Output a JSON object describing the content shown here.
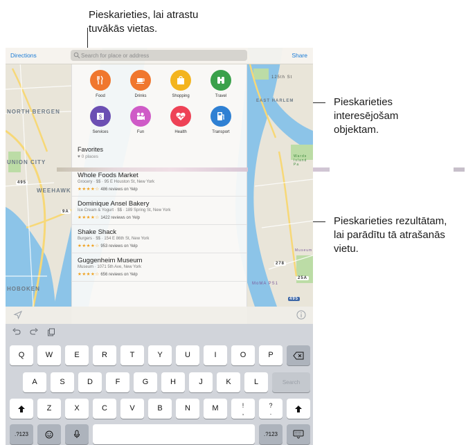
{
  "callouts": {
    "search": [
      "Pieskarieties, lai atrastu",
      "tuvākās vietas."
    ],
    "categories": [
      "Pieskarieties",
      "interesējošam",
      "objektam."
    ],
    "results": [
      "Pieskarieties rezultātam,",
      "lai parādītu tā atrašanās",
      "vietu."
    ]
  },
  "topbar": {
    "directions_label": "Directions",
    "share_label": "Share",
    "search_placeholder": "Search for place or address"
  },
  "map": {
    "labels": {
      "north_bergen": "NORTH BERGEN",
      "union_city": "UNION CITY",
      "weehawken": "WEEHAWK",
      "hoboken": "HOBOKEN",
      "east_harlem": "EAST HARLEM",
      "street_125": "125th St",
      "ward_island": "Wards Island Pa",
      "museum": "Museum",
      "moma": "MoMA PS1",
      "highway_278": "278",
      "highway_495": "495",
      "highway_9a": "9A",
      "highway_495b": "495",
      "highway_25a": "25A"
    }
  },
  "categories": [
    {
      "label": "Food",
      "color": "#f0772e",
      "icon": "fork-knife-icon"
    },
    {
      "label": "Drinks",
      "color": "#f0772e",
      "icon": "cup-icon"
    },
    {
      "label": "Shopping",
      "color": "#f3b41f",
      "icon": "bag-icon"
    },
    {
      "label": "Travel",
      "color": "#3aa14b",
      "icon": "binoculars-icon"
    },
    {
      "label": "Services",
      "color": "#6b4fb3",
      "icon": "bank-icon"
    },
    {
      "label": "Fun",
      "color": "#cf5bc7",
      "icon": "camera-icon"
    },
    {
      "label": "Health",
      "color": "#ee4256",
      "icon": "heart-icon"
    },
    {
      "label": "Transport",
      "color": "#2f80d3",
      "icon": "fuel-icon"
    }
  ],
  "favorites": {
    "title": "Favorites",
    "subtitle": "♥ 0 places"
  },
  "results": [
    {
      "name": "Whole Foods Market",
      "meta": "Grocery · $$ · 95 E Houston St, New York",
      "stars": "★★★★☆",
      "reviews": "486 reviews on Yelp"
    },
    {
      "name": "Dominique Ansel Bakery",
      "meta": "Ice Cream & Yogurt · $$ · 189 Spring St, New York",
      "stars": "★★★★☆",
      "reviews": "1422 reviews on Yelp"
    },
    {
      "name": "Shake Shack",
      "meta": "Burgers · $$ · 154 E 86th St, New York",
      "stars": "★★★★☆",
      "reviews": "953 reviews on Yelp"
    },
    {
      "name": "Guggenheim Museum",
      "meta": "Museum · 1071 5th Ave, New York",
      "stars": "★★★★☆",
      "reviews": "656 reviews on Yelp"
    }
  ],
  "keyboard": {
    "row1": [
      "Q",
      "W",
      "E",
      "R",
      "T",
      "Y",
      "U",
      "I",
      "O",
      "P"
    ],
    "row2": [
      "A",
      "S",
      "D",
      "F",
      "G",
      "H",
      "J",
      "K",
      "L"
    ],
    "row3": [
      "Z",
      "X",
      "C",
      "V",
      "B",
      "N",
      "M",
      "!\n,",
      "?\n."
    ],
    "search_key": "Search",
    "numbers_key": ".?123"
  }
}
